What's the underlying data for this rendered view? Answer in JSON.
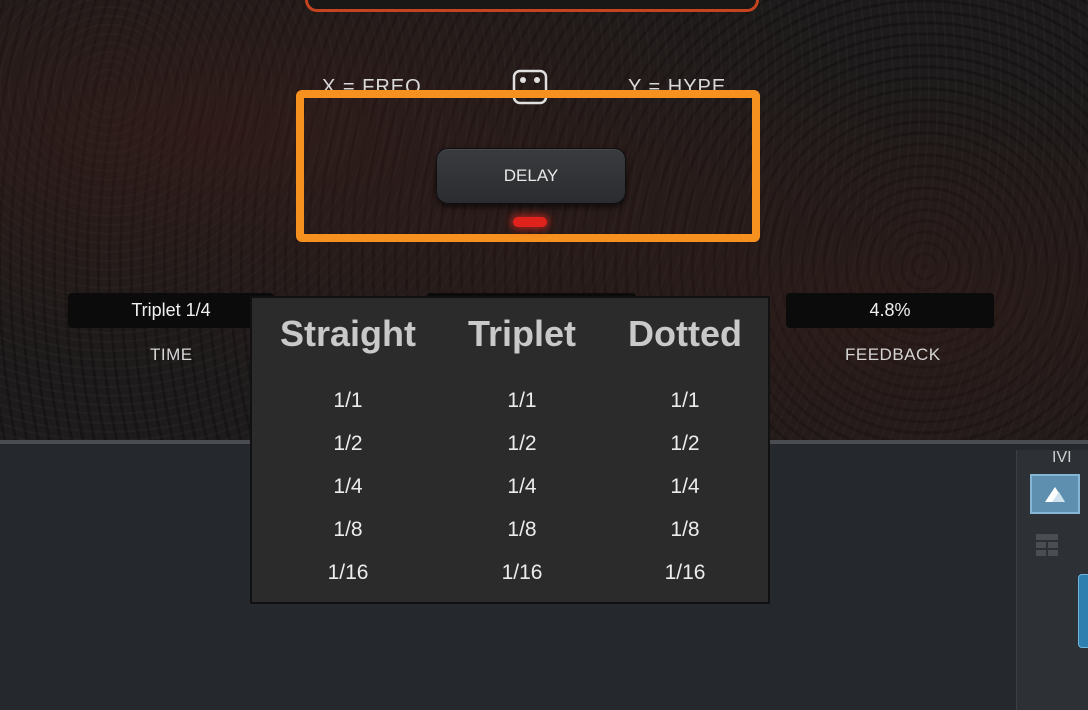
{
  "plugin": {
    "x_label": "X = FREQ",
    "y_label": "Y = HYPE",
    "delay_button": "DELAY",
    "time_value": "Triplet 1/4",
    "time_label": "TIME",
    "feedback_value": "4.8%",
    "feedback_label": "FEEDBACK",
    "highlight_color": "#f6901e",
    "led_color": "#e0221c"
  },
  "dropdown": {
    "columns": [
      {
        "header": "Straight",
        "items": [
          "1/1",
          "1/2",
          "1/4",
          "1/8",
          "1/16"
        ]
      },
      {
        "header": "Triplet",
        "items": [
          "1/1",
          "1/2",
          "1/4",
          "1/8",
          "1/16"
        ]
      },
      {
        "header": "Dotted",
        "items": [
          "1/1",
          "1/2",
          "1/4",
          "1/8",
          "1/16"
        ]
      }
    ]
  },
  "sidebar": {
    "label": "IVI",
    "icons": [
      "mountain-icon",
      "grid-icon"
    ],
    "accent": "#5f8fae"
  }
}
